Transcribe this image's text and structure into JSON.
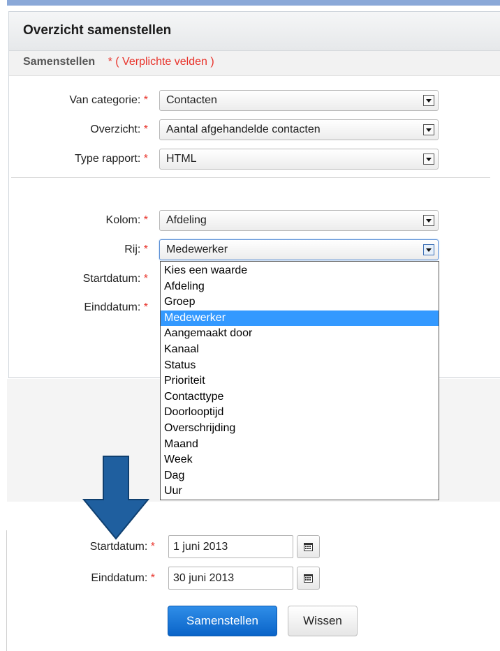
{
  "panel": {
    "title": "Overzicht samenstellen",
    "subheader_label": "Samenstellen",
    "required_note": "* ( Verplichte velden )"
  },
  "required_mark": "*",
  "fields": {
    "categorie": {
      "label": "Van categorie:",
      "value": "Contacten"
    },
    "overzicht": {
      "label": "Overzicht:",
      "value": "Aantal afgehandelde contacten"
    },
    "type": {
      "label": "Type rapport:",
      "value": "HTML"
    },
    "kolom": {
      "label": "Kolom:",
      "value": "Afdeling"
    },
    "rij": {
      "label": "Rij:",
      "value": "Medewerker"
    },
    "startdatum": {
      "label": "Startdatum:"
    },
    "einddatum": {
      "label": "Einddatum:"
    }
  },
  "dropdown": {
    "options": [
      "Kies een waarde",
      "Afdeling",
      "Groep",
      "Medewerker",
      "Aangemaakt door",
      "Kanaal",
      "Status",
      "Prioriteit",
      "Contacttype",
      "Doorlooptijd",
      "Overschrijding",
      "Maand",
      "Week",
      "Dag",
      "Uur"
    ],
    "selected_index": 3
  },
  "dates": {
    "start_label": "Startdatum:",
    "start_value": "1 juni 2013",
    "end_label": "Einddatum:",
    "end_value": "30 juni 2013"
  },
  "buttons": {
    "submit": "Samenstellen",
    "clear": "Wissen"
  },
  "icons": {
    "dropdown": "dropdown-arrow-icon",
    "calendar": "calendar-icon",
    "callout": "down-arrow-icon"
  },
  "colors": {
    "required": "#e8322a",
    "selection": "#3399ff",
    "primary_button": "#0a64c8",
    "callout_arrow": "#1f5f9f"
  }
}
